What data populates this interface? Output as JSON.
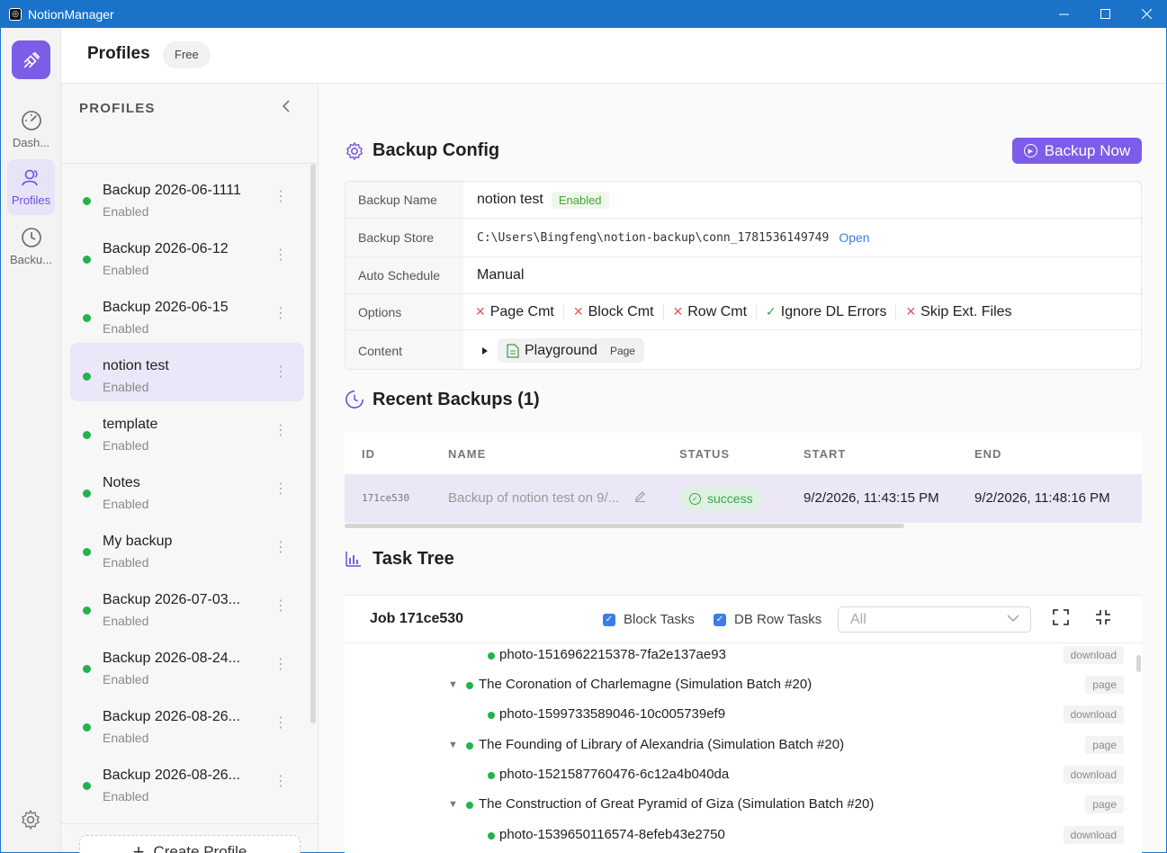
{
  "window": {
    "title": "NotionManager"
  },
  "rail": {
    "items": [
      {
        "label": "Dash..."
      },
      {
        "label": "Profiles"
      },
      {
        "label": "Backu..."
      }
    ]
  },
  "header": {
    "title": "Profiles",
    "badge": "Free"
  },
  "profiles": {
    "heading": "PROFILES",
    "items": [
      {
        "name": "Backup 2026-06-1111",
        "state": "Enabled"
      },
      {
        "name": "Backup 2026-06-12",
        "state": "Enabled"
      },
      {
        "name": "Backup 2026-06-15",
        "state": "Enabled"
      },
      {
        "name": "notion test",
        "state": "Enabled"
      },
      {
        "name": "template",
        "state": "Enabled"
      },
      {
        "name": "Notes",
        "state": "Enabled"
      },
      {
        "name": "My backup",
        "state": "Enabled"
      },
      {
        "name": "Backup 2026-07-03...",
        "state": "Enabled"
      },
      {
        "name": "Backup 2026-08-24...",
        "state": "Enabled"
      },
      {
        "name": "Backup 2026-08-26...",
        "state": "Enabled"
      },
      {
        "name": "Backup 2026-08-26...",
        "state": "Enabled"
      }
    ],
    "create_label": "Create Profile"
  },
  "config": {
    "title": "Backup Config",
    "backup_now": "Backup Now",
    "rows": {
      "name_label": "Backup Name",
      "name_value": "notion test",
      "name_status": "Enabled",
      "store_label": "Backup Store",
      "store_value": "C:\\Users\\Bingfeng\\notion-backup\\conn_1781536149749",
      "store_open": "Open",
      "schedule_label": "Auto Schedule",
      "schedule_value": "Manual",
      "options_label": "Options",
      "options": [
        {
          "label": "Page Cmt",
          "enabled": false
        },
        {
          "label": "Block Cmt",
          "enabled": false
        },
        {
          "label": "Row Cmt",
          "enabled": false
        },
        {
          "label": "Ignore DL Errors",
          "enabled": true
        },
        {
          "label": "Skip Ext. Files",
          "enabled": false
        }
      ],
      "content_label": "Content",
      "content_page": "Playground",
      "content_type": "Page"
    }
  },
  "recent": {
    "title": "Recent Backups (1)",
    "columns": {
      "id": "ID",
      "name": "NAME",
      "status": "STATUS",
      "start": "START",
      "end": "END"
    },
    "rows": [
      {
        "id": "171ce530",
        "name": "Backup of notion test on 9/...",
        "status": "success",
        "start": "9/2/2026, 11:43:15 PM",
        "end": "9/2/2026, 11:48:16 PM"
      }
    ]
  },
  "tree": {
    "title": "Task Tree",
    "job": "Job 171ce530",
    "block_tasks": "Block Tasks",
    "db_row_tasks": "DB Row Tasks",
    "filter": "All",
    "rows": [
      {
        "label": "photo-1516962215378-7fa2e137ae93",
        "tag": "download",
        "level": 2
      },
      {
        "label": "The Coronation of Charlemagne (Simulation Batch #20)",
        "tag": "page",
        "level": 1
      },
      {
        "label": "photo-1599733589046-10c005739ef9",
        "tag": "download",
        "level": 2
      },
      {
        "label": "The Founding of Library of Alexandria (Simulation Batch #20)",
        "tag": "page",
        "level": 1
      },
      {
        "label": "photo-1521587760476-6c12a4b040da",
        "tag": "download",
        "level": 2
      },
      {
        "label": "The Construction of Great Pyramid of Giza (Simulation Batch #20)",
        "tag": "page",
        "level": 1
      },
      {
        "label": "photo-1539650116574-8efeb43e2750",
        "tag": "download",
        "level": 2
      }
    ]
  },
  "colors": {
    "accent": "#7c5ce8",
    "titlebar": "#1a73c8",
    "success": "#22b34c",
    "link": "#3d7ee6"
  }
}
